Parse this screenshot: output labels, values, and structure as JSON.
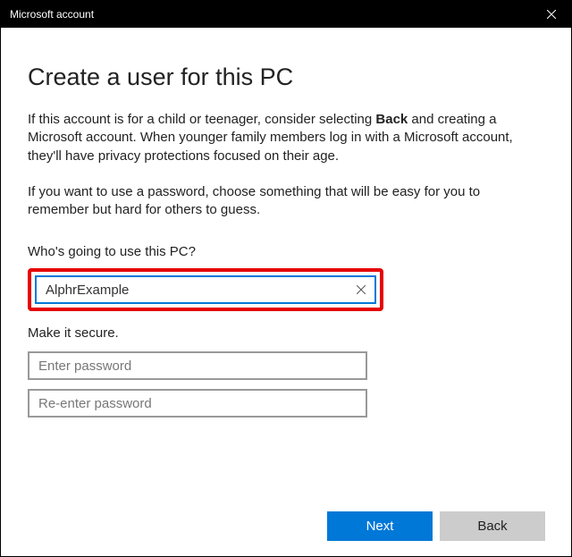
{
  "titlebar": {
    "title": "Microsoft account"
  },
  "heading": "Create a user for this PC",
  "desc1_pre": "If this account is for a child or teenager, consider selecting ",
  "desc1_bold": "Back",
  "desc1_post": " and creating a Microsoft account. When younger family members log in with a Microsoft account, they'll have privacy protections focused on their age.",
  "desc2": "If you want to use a password, choose something that will be easy for you to remember but hard for others to guess.",
  "username_label": "Who's going to use this PC?",
  "username_value": "AlphrExample",
  "secure_label": "Make it secure.",
  "password_placeholder": "Enter password",
  "confirm_placeholder": "Re-enter password",
  "buttons": {
    "next": "Next",
    "back": "Back"
  }
}
